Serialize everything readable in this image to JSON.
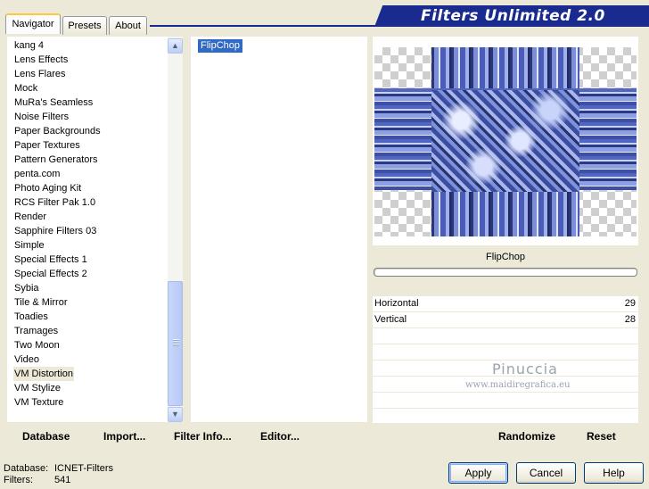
{
  "tabs": [
    {
      "label": "Navigator"
    },
    {
      "label": "Presets"
    },
    {
      "label": "About"
    }
  ],
  "banner": {
    "title": "Filters Unlimited 2.0",
    "color": "#1a2b8f"
  },
  "categories": [
    "kang 4",
    "Lens Effects",
    "Lens Flares",
    "Mock",
    "MuRa's Seamless",
    "Noise Filters",
    "Paper Backgrounds",
    "Paper Textures",
    "Pattern Generators",
    "penta.com",
    "Photo Aging Kit",
    "RCS Filter Pak 1.0",
    "Render",
    "Sapphire Filters 03",
    "Simple",
    "Special Effects 1",
    "Special Effects 2",
    "Sybia",
    "Tile & Mirror",
    "Toadies",
    "Tramages",
    "Two Moon",
    "Video",
    "VM Distortion",
    "VM Stylize",
    "VM Texture"
  ],
  "selected_category": "VM Distortion",
  "filters": [
    "FlipChop"
  ],
  "selected_filter": "FlipChop",
  "preview": {
    "filter_name": "FlipChop"
  },
  "params": [
    {
      "label": "Horizontal",
      "value": "29"
    },
    {
      "label": "Vertical",
      "value": "28"
    }
  ],
  "watermark": {
    "line1": "Pinuccia",
    "line2": "www.maidiregrafica.eu"
  },
  "links": {
    "database": "Database",
    "import": "Import...",
    "filter_info": "Filter Info...",
    "editor": "Editor...",
    "randomize": "Randomize",
    "reset": "Reset"
  },
  "status": {
    "database_label": "Database:",
    "database_value": "ICNET-Filters",
    "filters_label": "Filters:",
    "filters_value": "541"
  },
  "buttons": {
    "apply": "Apply",
    "cancel": "Cancel",
    "help": "Help"
  },
  "accent": "#316ac5"
}
